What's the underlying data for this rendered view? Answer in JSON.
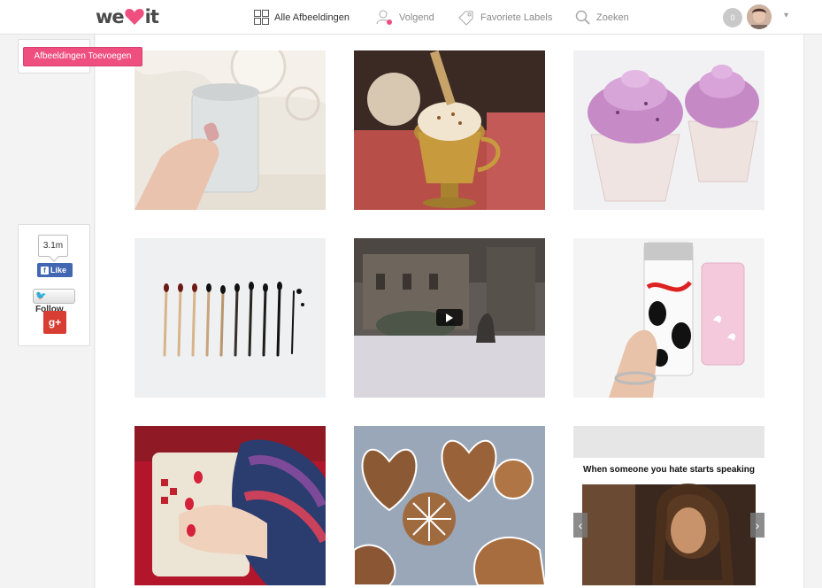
{
  "header": {
    "logo_text_left": "we",
    "logo_text_right": "it",
    "nav": {
      "all_images": "Alle Afbeeldingen",
      "following": "Volgend",
      "favorite_labels": "Favoriete Labels",
      "search": "Zoeken"
    },
    "notification_count": "0",
    "menu_caret": "▾"
  },
  "sidebar": {
    "add_images_button": "Afbeeldingen Toevoegen",
    "share": {
      "count": "3.1m",
      "facebook_like": "Like",
      "facebook_glyph": "f",
      "twitter_follow": "Follow",
      "twitter_glyph": "🐦",
      "googleplus_label": "g+"
    }
  },
  "feed": {
    "tiles": [
      {
        "subject": "hand holding clear can"
      },
      {
        "subject": "whipped cream drink in gold cup"
      },
      {
        "subject": "purple frosted cupcakes"
      },
      {
        "subject": "burnt matches sequence"
      },
      {
        "subject": "snowy castle video",
        "is_video": true
      },
      {
        "subject": "coca-cola light moschino cans"
      },
      {
        "subject": "hands with knit mittens and mug"
      },
      {
        "subject": "gingerbread cookies with icing"
      },
      {
        "subject": "meme gif",
        "caption": "When someone you hate starts speaking",
        "has_carousel": true
      }
    ],
    "arrow_left": "‹",
    "arrow_right": "›"
  },
  "colors": {
    "accent_pink": "#ef4f7f",
    "facebook_blue": "#4267b2",
    "googleplus_red": "#d73d32"
  }
}
